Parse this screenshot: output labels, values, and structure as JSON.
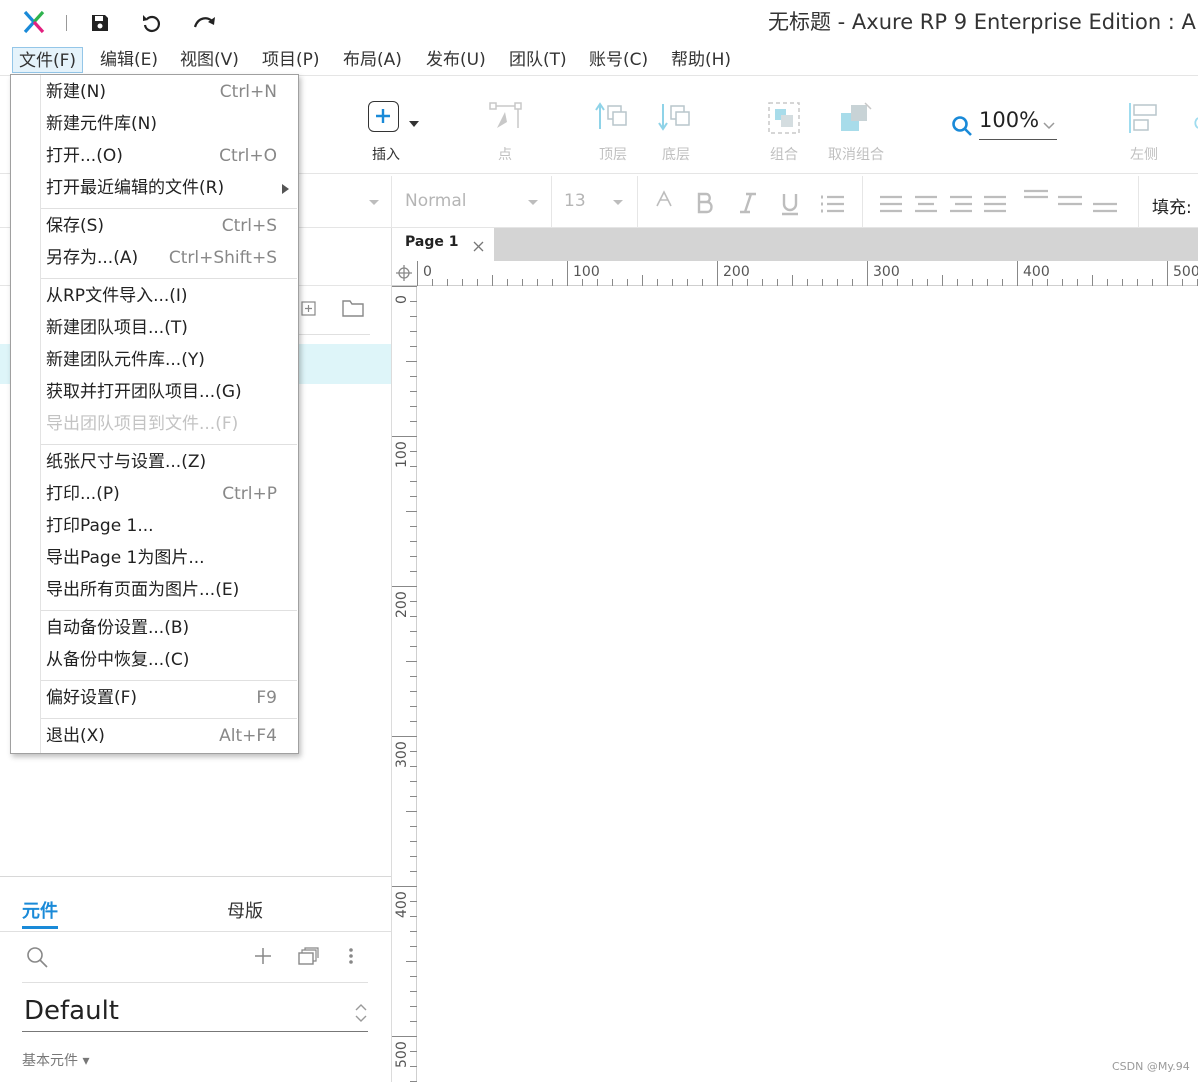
{
  "window": {
    "title": "无标题 - Axure RP 9 Enterprise Edition : A"
  },
  "menubar": [
    {
      "label": "文件(F)",
      "active": true
    },
    {
      "label": "编辑(E)"
    },
    {
      "label": "视图(V)"
    },
    {
      "label": "项目(P)"
    },
    {
      "label": "布局(A)"
    },
    {
      "label": "发布(U)"
    },
    {
      "label": "团队(T)"
    },
    {
      "label": "账号(C)"
    },
    {
      "label": "帮助(H)"
    }
  ],
  "file_menu": {
    "items": [
      {
        "label": "新建(N)",
        "shortcut": "Ctrl+N"
      },
      {
        "label": "新建元件库(N)",
        "shortcut": ""
      },
      {
        "label": "打开...(O)",
        "shortcut": "Ctrl+O"
      },
      {
        "label": "打开最近编辑的文件(R)",
        "shortcut": "",
        "submenu": true
      },
      {
        "label": "保存(S)",
        "shortcut": "Ctrl+S"
      },
      {
        "label": "另存为...(A)",
        "shortcut": "Ctrl+Shift+S"
      },
      {
        "label": "从RP文件导入...(I)",
        "shortcut": ""
      },
      {
        "label": "新建团队项目...(T)",
        "shortcut": ""
      },
      {
        "label": "新建团队元件库...(Y)",
        "shortcut": ""
      },
      {
        "label": "获取并打开团队项目...(G)",
        "shortcut": ""
      },
      {
        "label": "导出团队项目到文件...(F)",
        "shortcut": "",
        "disabled": true
      },
      {
        "label": "纸张尺寸与设置...(Z)",
        "shortcut": ""
      },
      {
        "label": "打印...(P)",
        "shortcut": "Ctrl+P"
      },
      {
        "label": "打印Page 1...",
        "shortcut": ""
      },
      {
        "label": "导出Page 1为图片...",
        "shortcut": ""
      },
      {
        "label": "导出所有页面为图片...(E)",
        "shortcut": ""
      },
      {
        "label": "自动备份设置...(B)",
        "shortcut": ""
      },
      {
        "label": "从备份中恢复...(C)",
        "shortcut": ""
      },
      {
        "label": "偏好设置(F)",
        "shortcut": "F9"
      },
      {
        "label": "退出(X)",
        "shortcut": "Alt+F4"
      }
    ]
  },
  "toolbar": {
    "insert": "插入",
    "point": "点",
    "top_layer": "顶层",
    "bottom_layer": "底层",
    "group": "组合",
    "ungroup": "取消组合",
    "zoom": "100%",
    "left_align": "左侧"
  },
  "formatbar": {
    "style": "Normal",
    "font_size": "13",
    "fill_label": "填充:"
  },
  "canvas": {
    "tab": "Page 1",
    "hruler": [
      "0",
      "100",
      "200",
      "300",
      "400",
      "500"
    ],
    "vruler": [
      "0",
      "100",
      "200",
      "300",
      "400",
      "500"
    ]
  },
  "left_panel": {
    "tab_widgets": "元件",
    "tab_masters": "母版",
    "library": "Default",
    "basic_widgets": "基本元件 ▾"
  },
  "watermark": "CSDN @My.94",
  "colors": {
    "accent": "#1a8ad8",
    "disabled": "#c0c0c0"
  }
}
